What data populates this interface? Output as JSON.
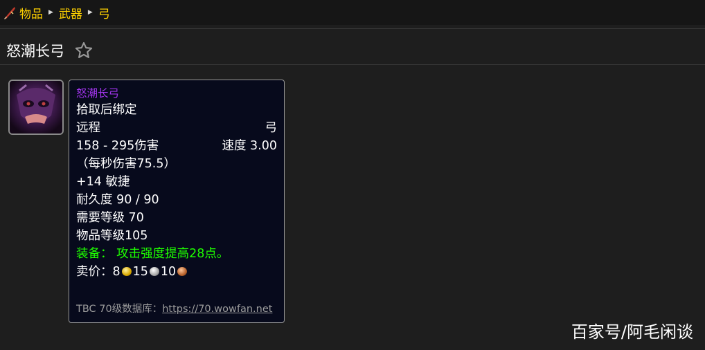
{
  "breadcrumb": {
    "icon": "weapon-category-icon",
    "items": [
      "物品",
      "武器",
      "弓"
    ]
  },
  "page": {
    "title": "怒潮长弓",
    "favorite_icon": "star-outline-icon"
  },
  "item": {
    "icon": "item-portrait-icon",
    "name": "怒潮长弓",
    "name_color": "#a335ee",
    "binding": "拾取后绑定",
    "slot": "远程",
    "type": "弓",
    "damage": "158 - 295伤害",
    "speed": "速度 3.00",
    "dps": "（每秒伤害75.5）",
    "stat": "+14 敏捷",
    "durability": "耐久度 90 / 90",
    "required_level": "需要等级 70",
    "item_level": "物品等级105",
    "equip_label": "装备：",
    "equip_effect": "攻击强度提高28点。",
    "equip_color": "#1eff00",
    "sell_label": "卖价：",
    "sell_gold": "8",
    "sell_silver": "15",
    "sell_copper": "10",
    "footer_text": "TBC 70级数据库：",
    "footer_link": "https://70.wowfan.net"
  },
  "watermark": "百家号/阿毛闲谈"
}
